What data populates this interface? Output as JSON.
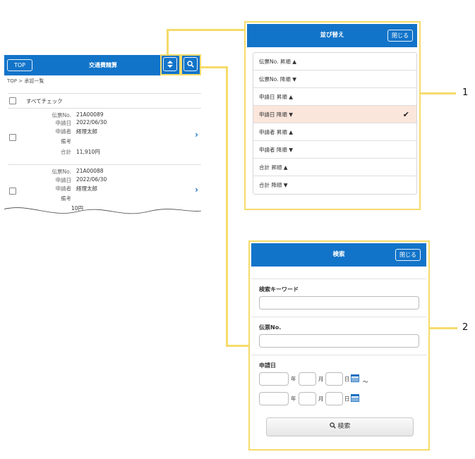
{
  "list_screen": {
    "top_button": "TOP",
    "title": "交通費精算",
    "breadcrumb": "TOP > 承認一覧",
    "check_all_label": "すべてチェック",
    "field_labels": [
      "伝票No.",
      "申請日",
      "申請者",
      "備考",
      "合計"
    ],
    "records": [
      {
        "slip_no": "21A00089",
        "date": "2022/06/30",
        "applicant": "経理太郎",
        "note": "",
        "total": "11,910円"
      },
      {
        "slip_no": "21A00088",
        "date": "2022/06/30",
        "applicant": "経理太郎",
        "note": "",
        "total": "  10円"
      }
    ],
    "icons": {
      "sort": "sort-icon",
      "search": "search-icon",
      "chevron": "chevron-right-icon"
    }
  },
  "sort_panel": {
    "title": "並び替え",
    "close_label": "閉じる",
    "options": [
      {
        "label": "伝票No. 昇順 ▲",
        "selected": false
      },
      {
        "label": "伝票No. 降順 ▼",
        "selected": false
      },
      {
        "label": "申請日 昇順 ▲",
        "selected": false
      },
      {
        "label": "申請日 降順 ▼",
        "selected": true
      },
      {
        "label": "申請者 昇順 ▲",
        "selected": false
      },
      {
        "label": "申請者 降順 ▼",
        "selected": false
      },
      {
        "label": "合計 昇順 ▲",
        "selected": false
      },
      {
        "label": "合計 降順 ▼",
        "selected": false
      }
    ],
    "check_mark": "✔"
  },
  "search_panel": {
    "title": "検索",
    "close_label": "閉じる",
    "keyword_label": "検索キーワード",
    "keyword_value": "",
    "slip_label": "伝票No.",
    "slip_value": "",
    "date_label": "申請日",
    "year_unit": "年",
    "month_unit": "月",
    "day_unit": "日",
    "range_sep": "～",
    "submit_label": "検索"
  },
  "callouts": {
    "one": "1",
    "two": "2"
  },
  "colors": {
    "header_blue": "#1274c9",
    "highlight_yellow": "#f5db6a",
    "selected_row": "#fbe6dc",
    "chevron_blue": "#1a6fc1"
  }
}
